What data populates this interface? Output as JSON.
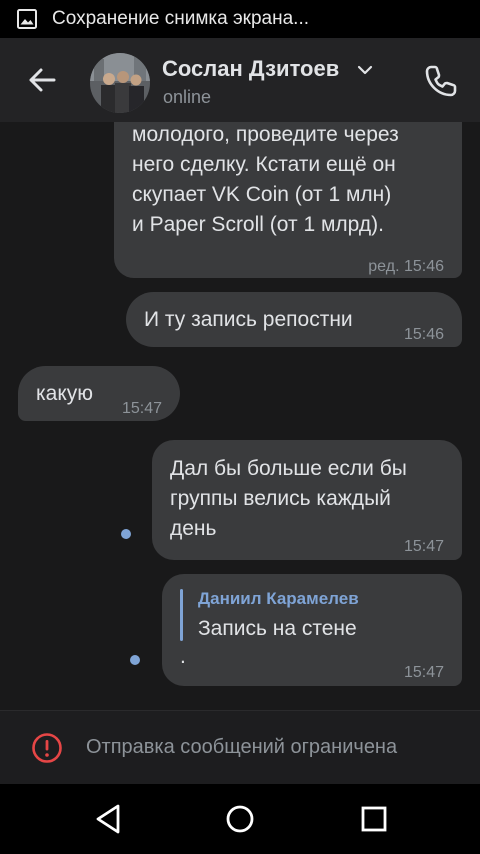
{
  "status_bar": {
    "notification_text": "Сохранение снимка экрана..."
  },
  "header": {
    "contact_name": "Сослан Дзитоев",
    "status": "online"
  },
  "messages": [
    {
      "text": "молодого, проведите через\nнего сделку. Кстати ещё он\nскупает VK Coin (от 1 млн)\nи Paper Scroll (от 1 млрд).",
      "time": "ред. 15:46",
      "outgoing": true
    },
    {
      "text": "И ту запись репостни",
      "time": "15:46",
      "outgoing": true
    },
    {
      "text": "какую",
      "time": "15:47",
      "outgoing": false
    },
    {
      "text": "Дал бы больше если бы\nгруппы велись каждый\nдень",
      "time": "15:47",
      "outgoing": true,
      "unread": true
    },
    {
      "reply_author": "Даниил Карамелев",
      "reply_text": "Запись на стене",
      "text": ".",
      "time": "15:47",
      "outgoing": true,
      "unread": true
    }
  ],
  "composer": {
    "restricted_text": "Отправка сообщений ограничена"
  },
  "colors": {
    "background": "#19191a",
    "bubble": "#3a3b3d",
    "accent": "#7fa4d6",
    "warning": "#e64646",
    "header": "#232325"
  }
}
